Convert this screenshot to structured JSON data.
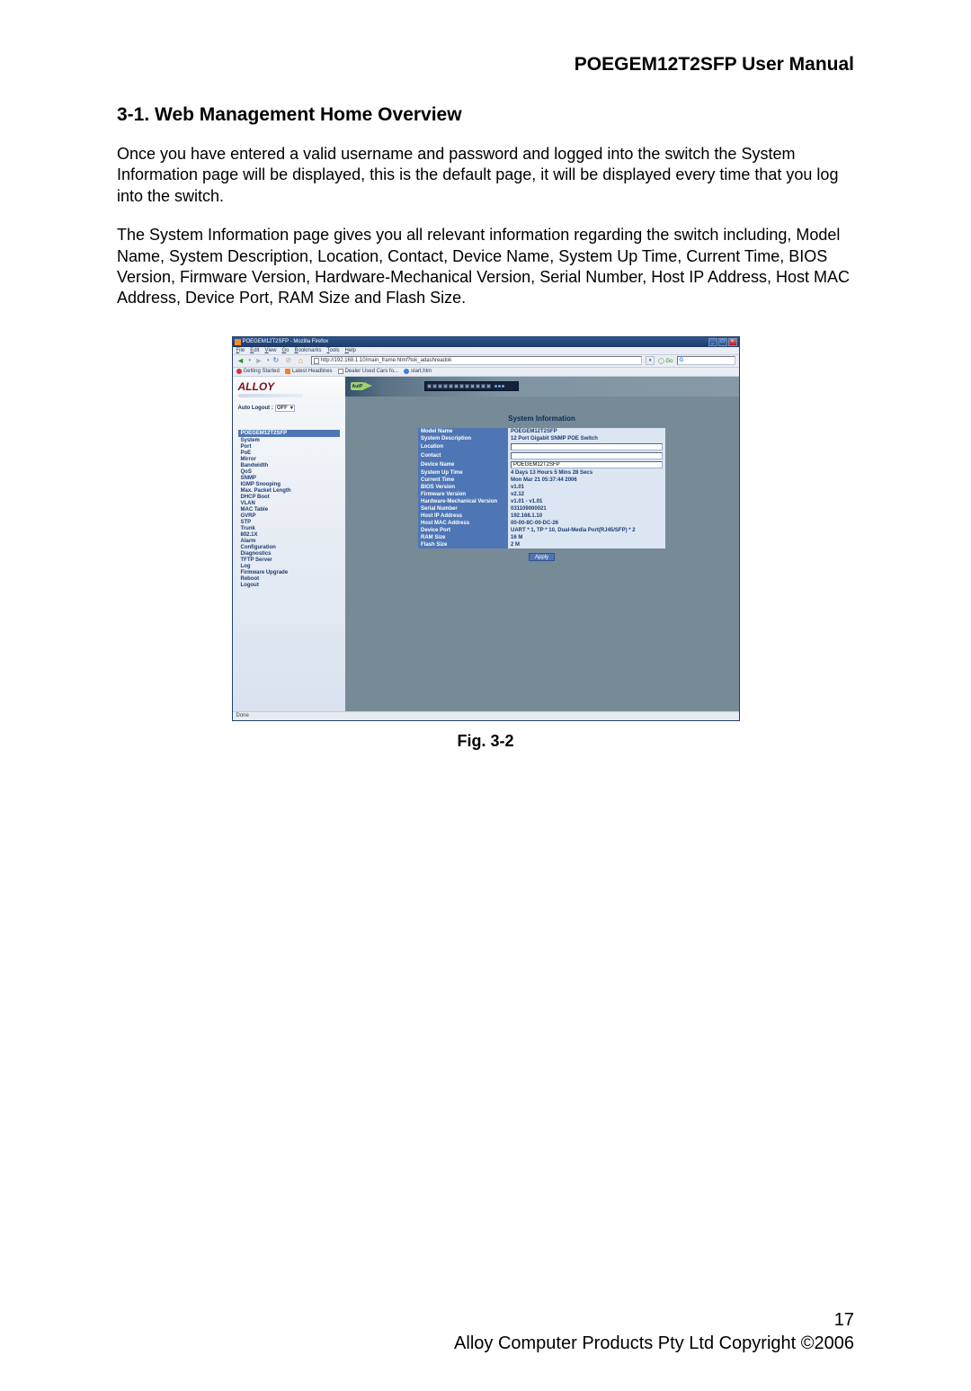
{
  "document": {
    "header_title": "POEGEM12T2SFP User Manual",
    "section_title": "3-1. Web Management Home Overview",
    "paragraph1": "Once you have entered a valid username and password and logged into the switch the System Information page will be displayed, this is the default page, it will be displayed every time that you log into the switch.",
    "paragraph2": "The System Information page gives you all relevant information regarding the switch including, Model Name, System Description, Location, Contact, Device Name, System Up Time, Current Time, BIOS Version, Firmware Version, Hardware-Mechanical Version, Serial Number, Host IP Address, Host MAC Address, Device Port, RAM Size and Flash Size.",
    "figure_caption": "Fig. 3-2",
    "page_number": "17",
    "copyright": "Alloy Computer Products Pty Ltd Copyright ©2006"
  },
  "browser": {
    "window_title": "POEGEM12T2SFP - Mozilla Firefox",
    "url": "http://192.168.1.10/main_frame.html?tok_adashreadok",
    "search_placeholder": "",
    "menus": {
      "file": "File",
      "edit": "Edit",
      "view": "View",
      "go": "Go",
      "bookmarks": "Bookmarks",
      "tools": "Tools",
      "help": "Help"
    },
    "bookmarks": {
      "getting_started": "Getting Started",
      "latest_headlines": "Latest Headlines",
      "dealer_used": "Dealer Used Cars fo...",
      "start": "start.htm"
    },
    "url_drop_symbol": "▾",
    "go_label": "Go",
    "status": "Done"
  },
  "app": {
    "logo_text": "ALLOY",
    "auto_logout_label": "Auto Logout :",
    "auto_logout_value": "OFF",
    "auto_logout_drop": "▾",
    "tree_header": "POEGEM12T2SFP",
    "badge": "AutP",
    "nav_items": [
      "System",
      "Port",
      "PoE",
      "Mirror",
      "Bandwidth",
      "QoS",
      "SNMP",
      "IGMP Snooping",
      "Max. Packet Length",
      "DHCP Boot",
      "VLAN",
      "MAC Table",
      "GVRP",
      "STP",
      "Trunk",
      "802.1X",
      "Alarm",
      "Configuration",
      "Diagnostics",
      "TFTP Server",
      "Log",
      "Firmware Upgrade",
      "Reboot",
      "Logout"
    ],
    "panel_title": "System Information",
    "rows": [
      {
        "label": "Model Name",
        "value": "POEGEM12T2SFP",
        "input": false
      },
      {
        "label": "System Description",
        "value": "12 Port Gigabit SNMP POE Switch",
        "input": false
      },
      {
        "label": "Location",
        "value": "",
        "input": true
      },
      {
        "label": "Contact",
        "value": "",
        "input": true
      },
      {
        "label": "Device Name",
        "value": "POEGEM12T2SFP",
        "input": true
      },
      {
        "label": "System Up Time",
        "value": "4 Days 13 Hours 5 Mins 28 Secs",
        "input": false
      },
      {
        "label": "Current Time",
        "value": "Mon Mar 21 05:37:44 2006",
        "input": false
      },
      {
        "label": "BIOS Version",
        "value": "v1.01",
        "input": false
      },
      {
        "label": "Firmware Version",
        "value": "v2.12",
        "input": false
      },
      {
        "label": "Hardware-Mechanical Version",
        "value": "v1.01 - v1.01",
        "input": false
      },
      {
        "label": "Serial Number",
        "value": "031109000021",
        "input": false
      },
      {
        "label": "Host IP Address",
        "value": "192.168.1.10",
        "input": false
      },
      {
        "label": "Host MAC Address",
        "value": "00-00-8C-00-DC-26",
        "input": false
      },
      {
        "label": "Device Port",
        "value": "UART * 1, TP * 10, Dual-Media Port(RJ45/SFP) * 2",
        "input": false
      },
      {
        "label": "RAM Size",
        "value": "16 M",
        "input": false
      },
      {
        "label": "Flash Size",
        "value": "2 M",
        "input": false
      }
    ],
    "apply_label": "Apply"
  }
}
